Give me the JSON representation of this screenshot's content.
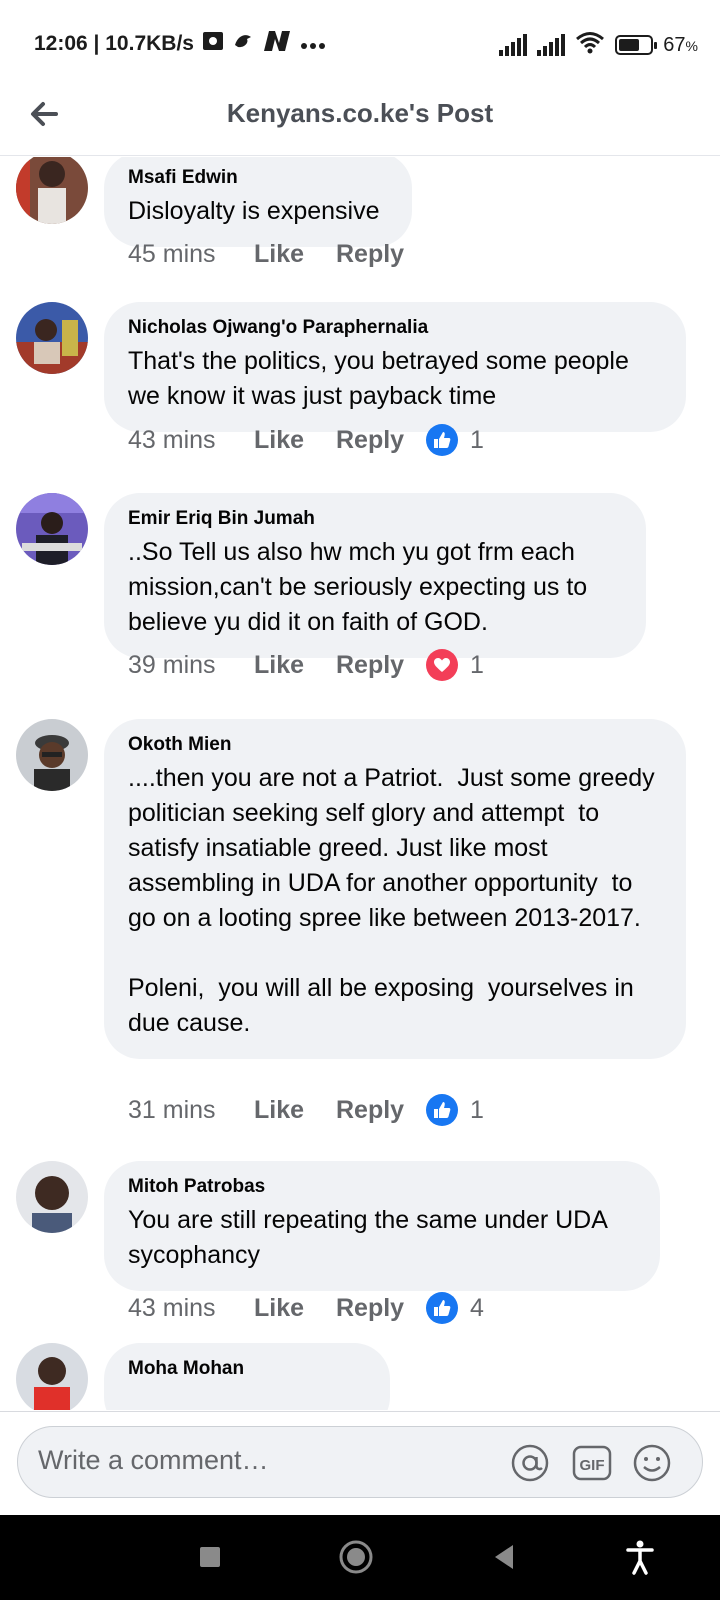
{
  "status_bar": {
    "time_speed": "12:06 | 10.7KB/s",
    "battery": "67",
    "battery_unit": "%",
    "battery_level": 0.67,
    "icons": [
      "sim-icon",
      "bird-icon",
      "n-app-icon",
      "more-dots-icon",
      "signal-icon",
      "signal-icon",
      "wifi-icon",
      "battery-icon"
    ]
  },
  "header": {
    "title": "Kenyans.co.ke's Post",
    "back_icon": "back-arrow-icon"
  },
  "comments": [
    {
      "author": "Msafi Edwin",
      "text": "Disloyalty is expensive",
      "time": "45 mins",
      "like_label": "Like",
      "reply_label": "Reply",
      "reaction": null,
      "reaction_count": null
    },
    {
      "author": "Nicholas Ojwang'o Paraphernalia",
      "text": "That's the politics, you betrayed some people we know it was just payback time",
      "time": "43 mins",
      "like_label": "Like",
      "reply_label": "Reply",
      "reaction": "like-icon",
      "reaction_count": "1"
    },
    {
      "author": "Emir Eriq Bin Jumah",
      "text": "..So Tell us also hw mch yu got frm each mission,can't be seriously expecting us to believe yu did it on faith of GOD.",
      "time": "39 mins",
      "like_label": "Like",
      "reply_label": "Reply",
      "reaction": "love-icon",
      "reaction_count": "1"
    },
    {
      "author": "Okoth Mien",
      "text": "....then you are not a Patriot.  Just some greedy politician seeking self glory and attempt  to satisfy insatiable greed. Just like most assembling in UDA for another opportunity  to go on a looting spree like between 2013-2017.\n\nPoleni,  you will all be exposing  yourselves in due cause.",
      "time": "31 mins",
      "like_label": "Like",
      "reply_label": "Reply",
      "reaction": "like-icon",
      "reaction_count": "1"
    },
    {
      "author": "Mitoh Patrobas",
      "text": "You are still repeating the same under UDA sycophancy",
      "time": "43 mins",
      "like_label": "Like",
      "reply_label": "Reply",
      "reaction": "like-icon",
      "reaction_count": "4"
    },
    {
      "author": "Moha Mohan",
      "text": "",
      "time": "",
      "like_label": "",
      "reply_label": "",
      "reaction": null,
      "reaction_count": null
    }
  ],
  "composer": {
    "placeholder": "Write a comment…",
    "icons": [
      "mention-icon",
      "gif-icon",
      "emoji-icon"
    ]
  },
  "nav_bar": {
    "icons": [
      "recents-icon",
      "home-icon",
      "back-icon",
      "accessibility-icon"
    ]
  },
  "colors": {
    "bubble": "#f0f2f5",
    "like_blue": "#1877f2",
    "love_red": "#f33e58",
    "muted_text": "#65676b"
  }
}
